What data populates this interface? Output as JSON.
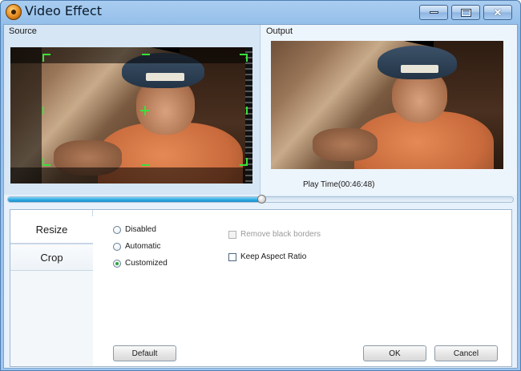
{
  "window": {
    "title": "Video Effect",
    "controls": {
      "minimize": "minimize",
      "maximize": "maximize",
      "close": "✕"
    }
  },
  "preview": {
    "source_label": "Source",
    "output_label": "Output",
    "play_time": "Play Time(00:46:48)",
    "progress_fraction": 0.502
  },
  "tabs": [
    {
      "label": "Resize",
      "selected": false
    },
    {
      "label": "Crop",
      "selected": true
    }
  ],
  "crop": {
    "mode_options": [
      {
        "label": "Disabled",
        "checked": false
      },
      {
        "label": "Automatic",
        "checked": false
      },
      {
        "label": "Customized",
        "checked": true
      }
    ],
    "remove_black_borders": {
      "label": "Remove black borders",
      "checked": false,
      "enabled": false
    },
    "keep_aspect_ratio": {
      "label": "Keep Aspect Ratio",
      "checked": false,
      "enabled": true
    }
  },
  "buttons": {
    "default": "Default",
    "ok": "OK",
    "cancel": "Cancel"
  },
  "colors": {
    "crop_handle": "#39e23a",
    "progress": "#28a7e0",
    "radio_checked": "#27a838"
  }
}
